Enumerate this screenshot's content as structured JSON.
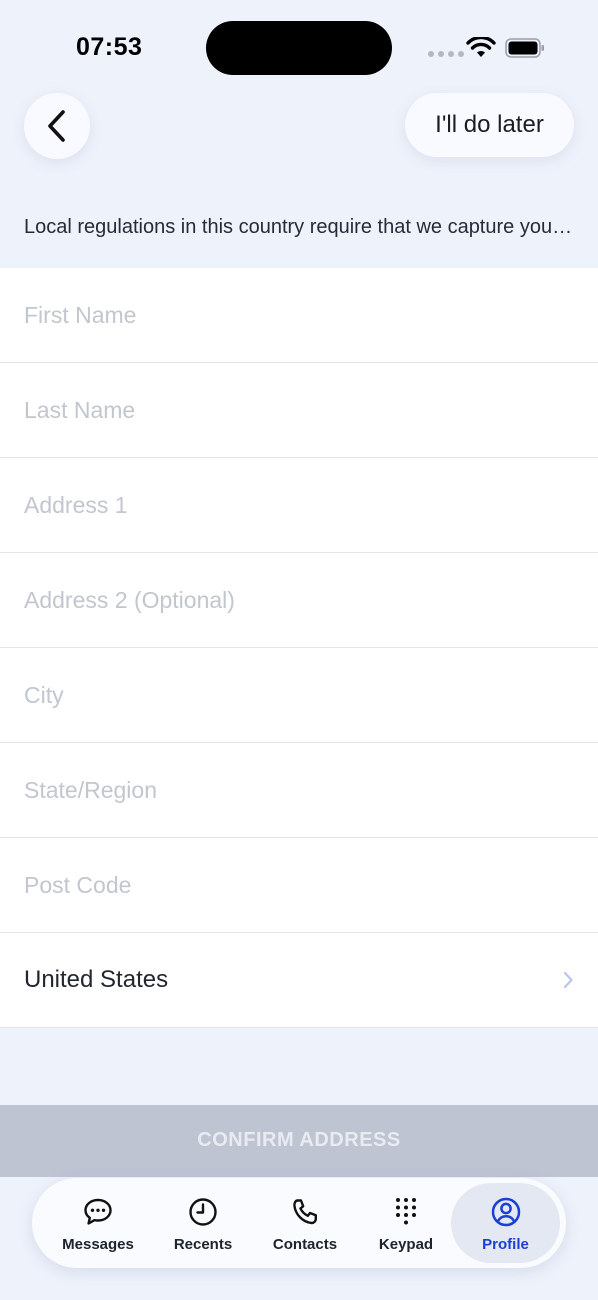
{
  "status_bar": {
    "time": "07:53"
  },
  "header": {
    "later_label": "I'll do later"
  },
  "notice": "Local regulations in this country require that we capture your address",
  "form": {
    "first_name_placeholder": "First Name",
    "last_name_placeholder": "Last Name",
    "address1_placeholder": "Address 1",
    "address2_placeholder": "Address 2 (Optional)",
    "city_placeholder": "City",
    "state_placeholder": "State/Region",
    "postcode_placeholder": "Post Code",
    "country": "United States"
  },
  "confirm_label": "CONFIRM ADDRESS",
  "tabbar": {
    "items": [
      {
        "label": "Messages",
        "icon": "chat-bubble-icon"
      },
      {
        "label": "Recents",
        "icon": "clock-icon"
      },
      {
        "label": "Contacts",
        "icon": "phone-icon"
      },
      {
        "label": "Keypad",
        "icon": "keypad-icon"
      },
      {
        "label": "Profile",
        "icon": "user-circle-icon",
        "active": true
      }
    ]
  },
  "colors": {
    "background": "#eef2fb",
    "accent": "#1a3ed6",
    "confirm_disabled": "#bfc4d3"
  }
}
